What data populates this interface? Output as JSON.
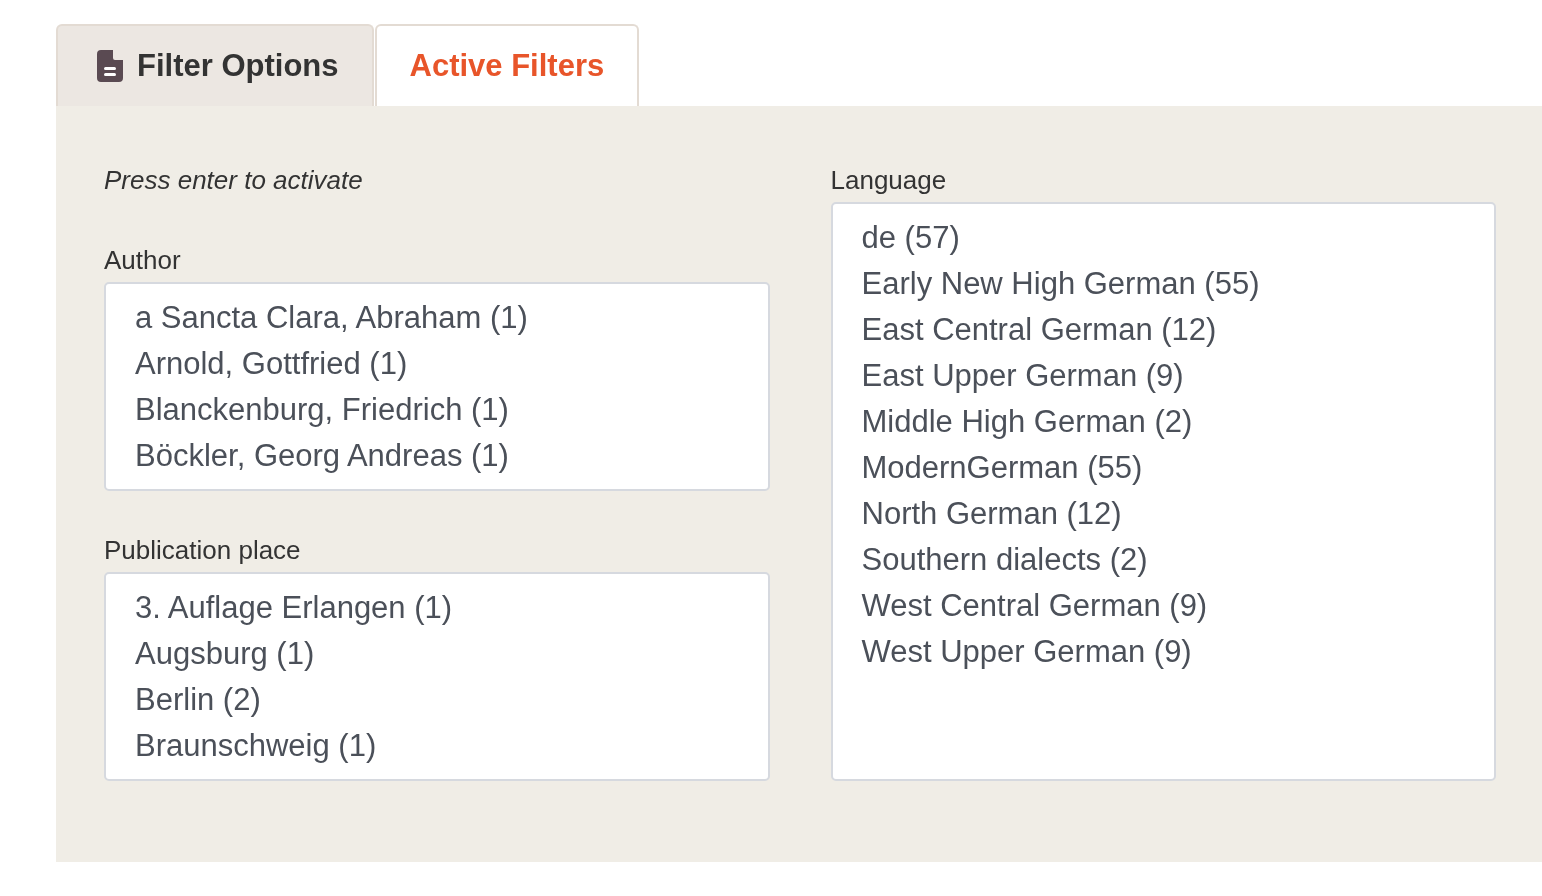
{
  "tabs": [
    {
      "label": "Filter Options",
      "icon": true,
      "selected": true
    },
    {
      "label": "Active Filters",
      "icon": false,
      "selected": false
    }
  ],
  "panel": {
    "columns": [
      {
        "hint": "Press enter to activate",
        "filters": [
          {
            "label": "Author",
            "options": [
              {
                "label": "a Sancta Clara, Abraham (1)",
                "selected": false
              },
              {
                "label": "Arnold, Gottfried (1)",
                "selected": false
              },
              {
                "label": "Blanckenburg, Friedrich (1)",
                "selected": false
              },
              {
                "label": "Böckler, Georg Andreas (1)",
                "selected": false
              }
            ]
          },
          {
            "label": "Publication place",
            "options": [
              {
                "label": "3. Auflage Erlangen (1)",
                "selected": false
              },
              {
                "label": "Augsburg (1)",
                "selected": false
              },
              {
                "label": "Berlin (2)",
                "selected": false
              },
              {
                "label": "Braunschweig (1)",
                "selected": false
              }
            ]
          }
        ]
      },
      {
        "filters": [
          {
            "label": "Language",
            "options": [
              {
                "label": "de (57)",
                "selected": false
              },
              {
                "label": "Early New High German (55)",
                "selected": false
              },
              {
                "label": "East Central German (12)",
                "selected": false
              },
              {
                "label": "East Upper German (9)",
                "selected": false
              },
              {
                "label": "Middle High German (2)",
                "selected": false
              },
              {
                "label": "ModernGerman (55)",
                "selected": false
              },
              {
                "label": "North German (12)",
                "selected": false
              },
              {
                "label": "Southern dialects (2)",
                "selected": false
              },
              {
                "label": "West Central German (9)",
                "selected": false
              },
              {
                "label": "West Upper German (9)",
                "selected": false
              }
            ]
          }
        ]
      }
    ]
  }
}
